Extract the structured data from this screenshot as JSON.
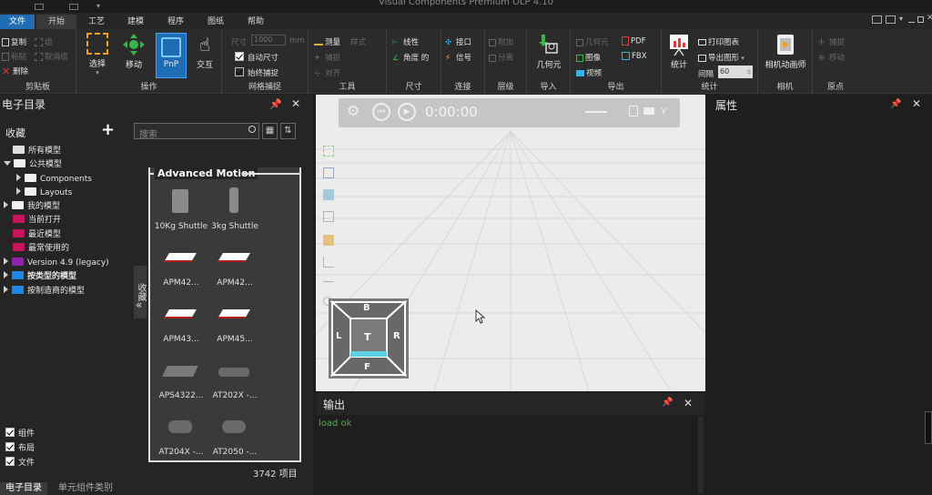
{
  "app": {
    "title": "Visual Components Premium OLP 4.10"
  },
  "menu_tabs": [
    "文件",
    "开始",
    "工艺",
    "建模",
    "程序",
    "图纸",
    "帮助"
  ],
  "ribbon": {
    "clipboard": {
      "label": "剪贴板",
      "copy": "复制",
      "paste": "粘贴",
      "delete": "删除",
      "group": "组",
      "ungroup": "取消组"
    },
    "manipulation": {
      "label": "操作",
      "select": "选择",
      "move": "移动",
      "pnp": "PnP",
      "interact": "交互"
    },
    "grid_snap": {
      "label": "网格捕捉",
      "size": "尺寸",
      "size_value": "1000",
      "size_unit": "mm",
      "auto_size": "自动尺寸",
      "always_snap": "始终捕捉"
    },
    "tools": {
      "label": "工具",
      "measure": "测量",
      "mode": "样式",
      "snap": "捕捉",
      "align": "对齐"
    },
    "dimension": {
      "label": "尺寸",
      "linear": "线性",
      "angle": "角度 的"
    },
    "connect": {
      "label": "连接",
      "interface": "接口",
      "signal": "信号"
    },
    "hierarchy": {
      "label": "层级",
      "attach": "附加",
      "detach": "分离"
    },
    "import": {
      "label": "导入",
      "geometry": "几何元"
    },
    "export": {
      "label": "导出",
      "geometry": "几何元",
      "image": "图像",
      "video": "视频",
      "pdf": "PDF",
      "fbx": "FBX"
    },
    "statistics": {
      "label": "统计",
      "stats": "统计",
      "print_chart": "打印图表",
      "export_chart": "导出图形",
      "interval": "间隔",
      "interval_value": "60",
      "interval_unit": "s"
    },
    "camera": {
      "label": "相机",
      "animator": "相机动画师"
    },
    "origin": {
      "label": "原点",
      "snap": "捕捉",
      "move": "移动"
    }
  },
  "catalog": {
    "title": "电子目录",
    "favorites": "收藏",
    "search_placeholder": "搜索",
    "tree": [
      {
        "label": "所有模型",
        "color": "#e0e0e0"
      },
      {
        "label": "公共模型",
        "color": "#f0f0f0"
      },
      {
        "label": "Components",
        "color": "#f0f0f0"
      },
      {
        "label": "Layouts",
        "color": "#f0f0f0"
      },
      {
        "label": "我的模型",
        "color": "#f0f0f0"
      },
      {
        "label": "当前打开",
        "color": "#c2185b"
      },
      {
        "label": "最近模型",
        "color": "#c2185b"
      },
      {
        "label": "最常使用的",
        "color": "#c2185b"
      },
      {
        "label": "Version 4.9 (legacy)",
        "color": "#8e24aa"
      },
      {
        "label": "按类型的模型",
        "color": "#1e88e5"
      },
      {
        "label": "按制造商的模型",
        "color": "#1e88e5"
      }
    ],
    "gallery_title": "Advanced Motion",
    "gallery_items": [
      "10Kg Shuttle",
      "3kg Shuttle",
      "APM42...",
      "APM42...",
      "APM43...",
      "APM45...",
      "APS4322...",
      "AT202X -...",
      "AT204X -...",
      "AT2050 -..."
    ],
    "side_tab": "收藏",
    "count": "3742 项目",
    "filters": [
      "组件",
      "布局",
      "文件"
    ],
    "bottom_tabs": [
      "电子目录",
      "单元组件类别"
    ]
  },
  "viewport": {
    "time": "0:00:00",
    "cube": {
      "top": "B",
      "center": "T",
      "left": "L",
      "right": "R",
      "bottom": "F"
    }
  },
  "output": {
    "title": "输出",
    "message": "load ok",
    "message_color": "#4caf50"
  },
  "properties": {
    "title": "属性"
  }
}
